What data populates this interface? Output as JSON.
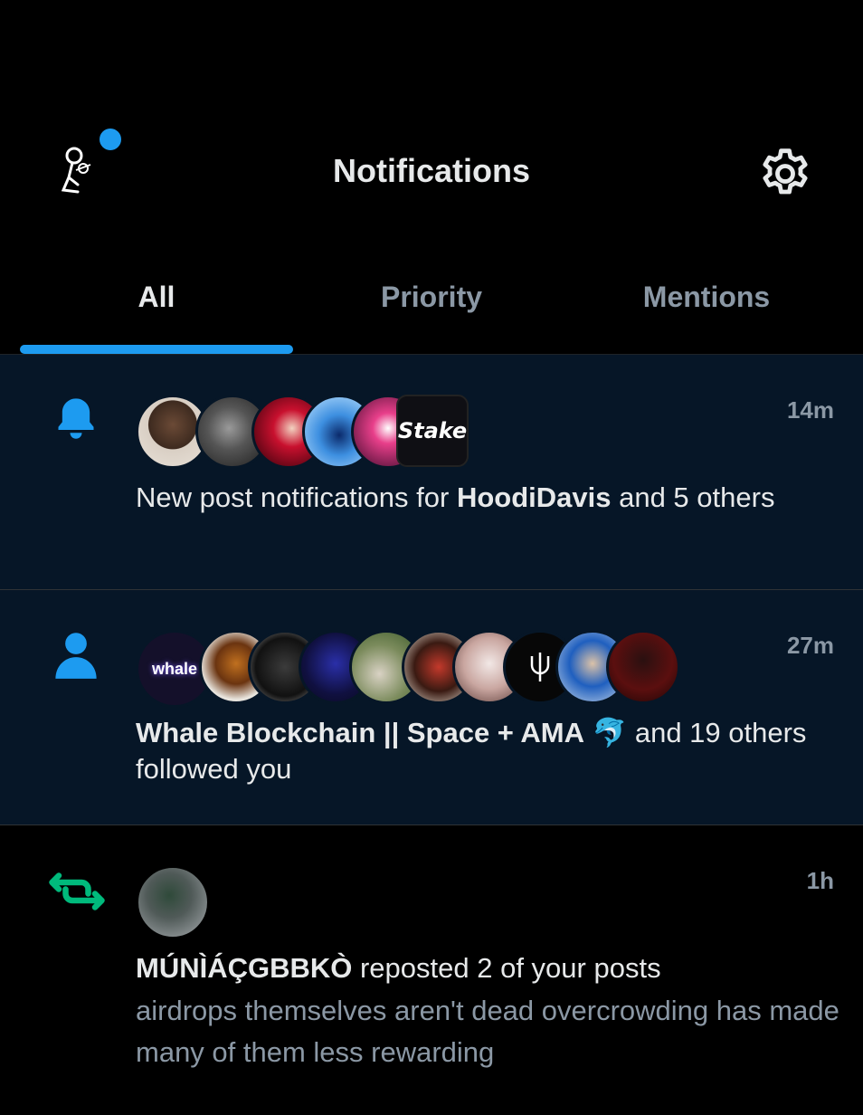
{
  "header": {
    "title": "Notifications",
    "profile_icon": "profile-avatar-icon",
    "settings_icon": "gear-icon",
    "unread_dot_color": "#1d9bf0"
  },
  "tabs": [
    {
      "label": "All",
      "active": true
    },
    {
      "label": "Priority",
      "active": false
    },
    {
      "label": "Mentions",
      "active": false
    }
  ],
  "notifications": [
    {
      "type": "new-post",
      "icon": "bell-icon",
      "time": "14m",
      "text_pre": "New post notifications for ",
      "text_bold": "HoodiDavis",
      "text_post": " and 5 others",
      "avatar_badge": "Stake"
    },
    {
      "type": "follow",
      "icon": "person-icon",
      "time": "27m",
      "text_bold": "Whale Blockchain || Space + AMA",
      "text_emoji": "🐬",
      "text_post": " and 19 others followed you",
      "avatar_badge": "whale"
    },
    {
      "type": "repost",
      "icon": "repost-icon",
      "time": "1h",
      "text_bold": "MÚNÌÁÇGBBKÒ",
      "text_post": " reposted 2 of your posts",
      "preview": "airdrops themselves aren't dead overcrowding has made many of them less rewarding"
    }
  ],
  "colors": {
    "accent": "#1d9bf0",
    "repost_green": "#00ba7c",
    "unread_bg": "#061627"
  }
}
